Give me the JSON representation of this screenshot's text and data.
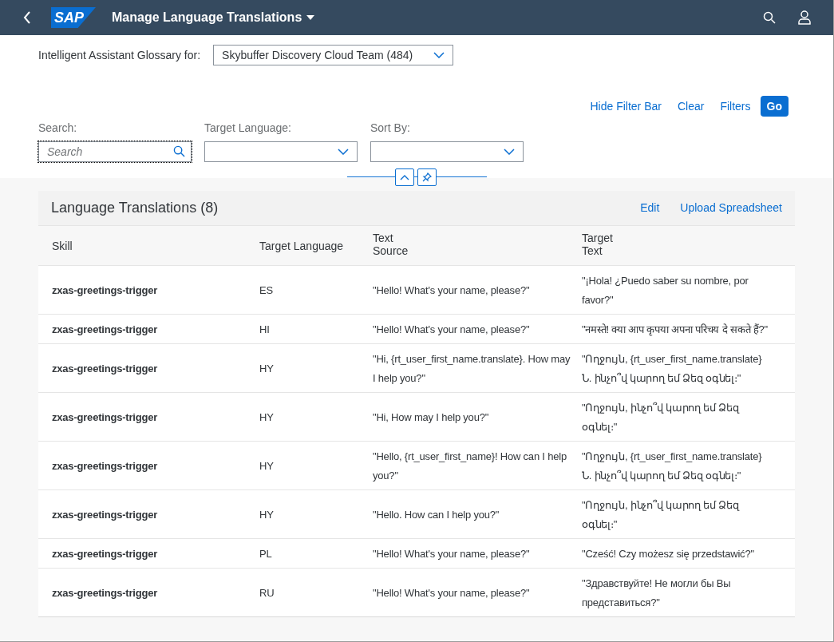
{
  "shell": {
    "title": "Manage Language Translations",
    "logo": "SAP"
  },
  "glossary": {
    "label": "Intelligent Assistant Glossary for:",
    "value": "Skybuffer Discovery Cloud Team (484)"
  },
  "filter_actions": [
    {
      "label": "Hide Filter Bar",
      "kind": "link"
    },
    {
      "label": "Clear",
      "kind": "link"
    },
    {
      "label": "Filters",
      "kind": "link"
    },
    {
      "label": "Go",
      "kind": "primary"
    }
  ],
  "filters": [
    {
      "label": "Search:",
      "kind": "search",
      "placeholder": "Search"
    },
    {
      "label": "Target Language:",
      "kind": "select"
    },
    {
      "label": "Sort By:",
      "kind": "select"
    }
  ],
  "table": {
    "title": "Language Translations (8)",
    "actions": [
      "Edit",
      "Upload Spreadsheet"
    ],
    "columns": [
      "Skill",
      "Target Language",
      "Text Source",
      "Target Text"
    ],
    "rows": [
      [
        "zxas-greetings-trigger",
        "ES",
        "\"Hello! What's your name, please?\"",
        "\"¡Hola! ¿Puedo saber su nombre, por favor?\""
      ],
      [
        "zxas-greetings-trigger",
        "HI",
        "\"Hello! What's your name, please?\"",
        "\"नमस्ते! क्या आप कृपया अपना परिचय दे सकते हैं?\""
      ],
      [
        "zxas-greetings-trigger",
        "HY",
        "\"Hi, {rt_user_first_name.translate}. How may I help you?\"",
        "\"Ողջույն, {rt_user_first_name.translate} Ն. ինչո՞վ կարող եմ Ձեզ օգնել։\""
      ],
      [
        "zxas-greetings-trigger",
        "HY",
        "\"Hi, How may I help you?\"",
        "\"Ողջույն, ինչո՞վ կարող եմ Ձեզ օգնել։\""
      ],
      [
        "zxas-greetings-trigger",
        "HY",
        "\"Hello, {rt_user_first_name}! How can I help you?\"",
        "\"Ողջույն, {rt_user_first_name.translate} Ն. ինչո՞վ կարող եմ Ձեզ օգնել։\""
      ],
      [
        "zxas-greetings-trigger",
        "HY",
        "\"Hello. How can I help you?\"",
        "\"Ողջույն, ինչո՞վ կարող եմ Ձեզ օգնել։\""
      ],
      [
        "zxas-greetings-trigger",
        "PL",
        "\"Hello! What's your name, please?\"",
        "\"Cześć! Czy możesz się przedstawić?\""
      ],
      [
        "zxas-greetings-trigger",
        "RU",
        "\"Hello! What's your name, please?\"",
        "\"Здравствуйте! Не могли бы Вы представиться?\""
      ]
    ]
  }
}
